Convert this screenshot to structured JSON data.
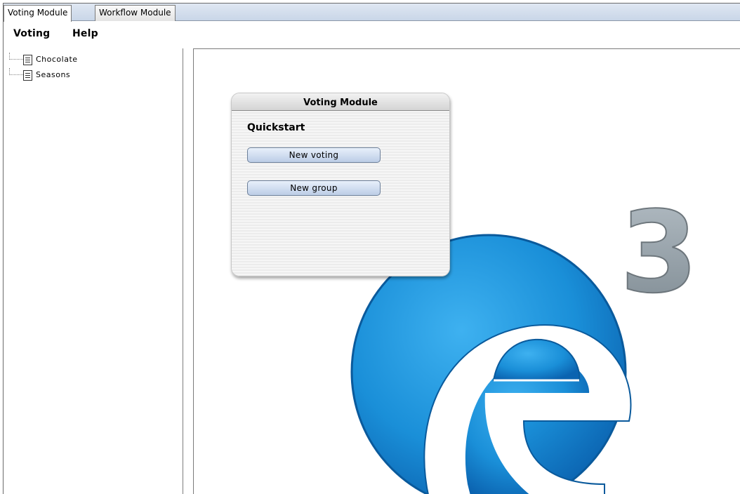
{
  "tabs": [
    {
      "label": "Voting Module",
      "active": true
    },
    {
      "label": "Workflow Module",
      "active": false
    }
  ],
  "menu": {
    "voting": "Voting",
    "help": "Help"
  },
  "tree": {
    "items": [
      {
        "label": "Chocolate",
        "icon": "document-icon"
      },
      {
        "label": "Seasons",
        "icon": "document-icon"
      }
    ]
  },
  "card": {
    "title": "Voting Module",
    "quickstart": "Quickstart",
    "new_voting": "New voting",
    "new_group": "New group"
  },
  "logo": {
    "exponent": "3",
    "brand_blue": "#1a8fd8",
    "brand_grey": "#9aa6ae"
  }
}
